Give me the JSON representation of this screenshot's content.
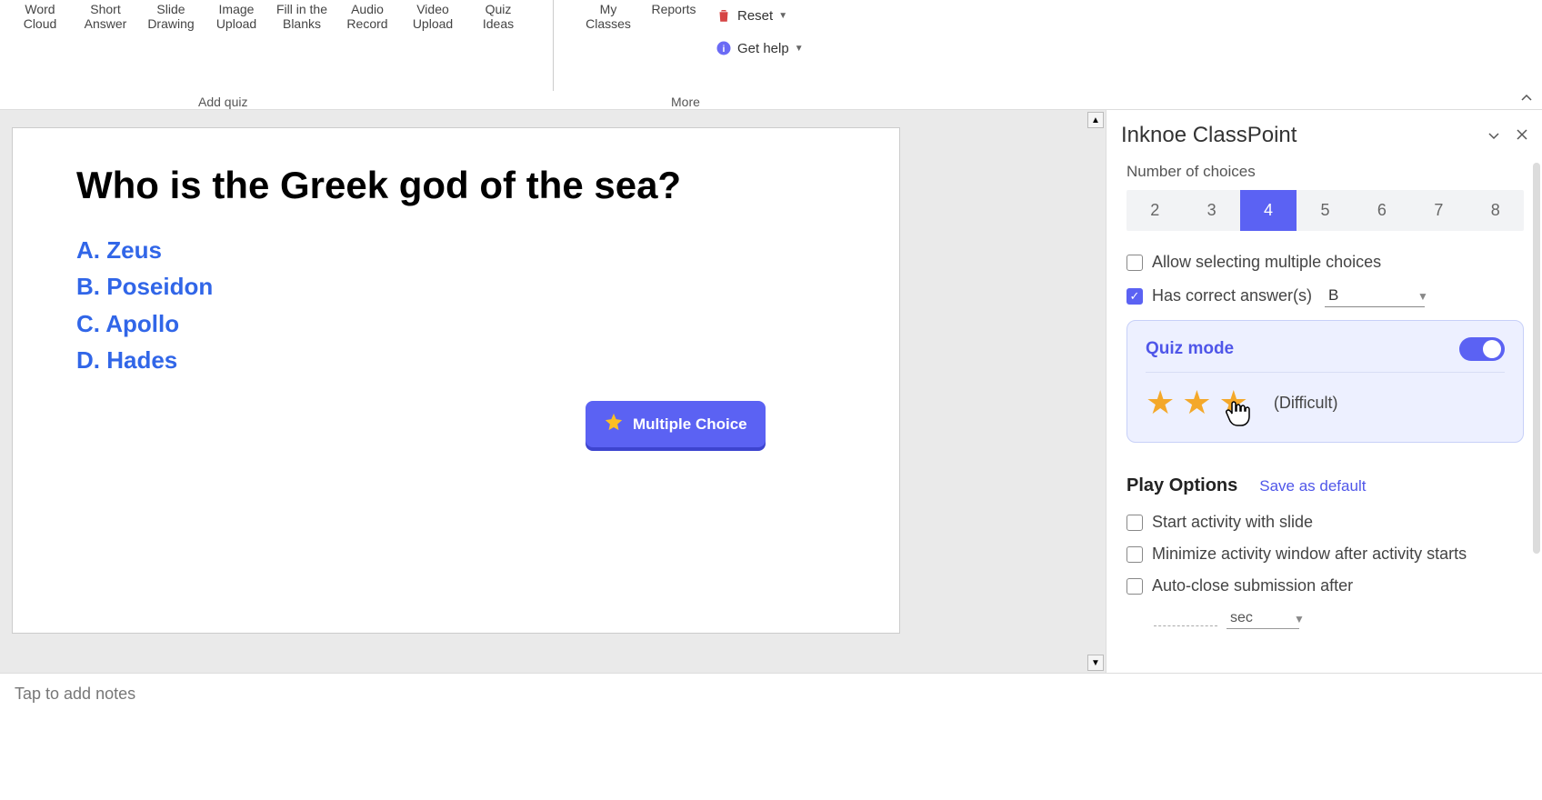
{
  "ribbon": {
    "items": [
      {
        "l1": "Word",
        "l2": "Cloud"
      },
      {
        "l1": "Short",
        "l2": "Answer"
      },
      {
        "l1": "Slide",
        "l2": "Drawing"
      },
      {
        "l1": "Image",
        "l2": "Upload"
      },
      {
        "l1": "Fill in the",
        "l2": "Blanks"
      },
      {
        "l1": "Audio",
        "l2": "Record"
      },
      {
        "l1": "Video",
        "l2": "Upload"
      },
      {
        "l1": "Quiz",
        "l2": "Ideas"
      }
    ],
    "group1": "Add quiz",
    "more_items": [
      {
        "l1": "My",
        "l2": "Classes"
      },
      {
        "l1": "Reports",
        "l2": ""
      }
    ],
    "reset": "Reset",
    "help": "Get help",
    "group2": "More"
  },
  "slide": {
    "question": "Who is the Greek god of the sea?",
    "answers": [
      "A. Zeus",
      "B. Poseidon",
      "C. Apollo",
      "D. Hades"
    ],
    "mc_label": "Multiple Choice"
  },
  "panel": {
    "title": "Inknoe ClassPoint",
    "num_choices_label": "Number of choices",
    "choice_nums": [
      "2",
      "3",
      "4",
      "5",
      "6",
      "7",
      "8"
    ],
    "choice_active": "4",
    "allow_multi": "Allow selecting multiple choices",
    "has_correct": "Has correct answer(s)",
    "correct_val": "B",
    "quiz_mode": "Quiz mode",
    "difficulty": "(Difficult)",
    "play_options": "Play Options",
    "save_default": "Save as default",
    "opt1": "Start activity with slide",
    "opt2": "Minimize activity window after activity starts",
    "opt3": "Auto-close submission after",
    "sec_label": "sec"
  },
  "notes": "Tap to add notes"
}
